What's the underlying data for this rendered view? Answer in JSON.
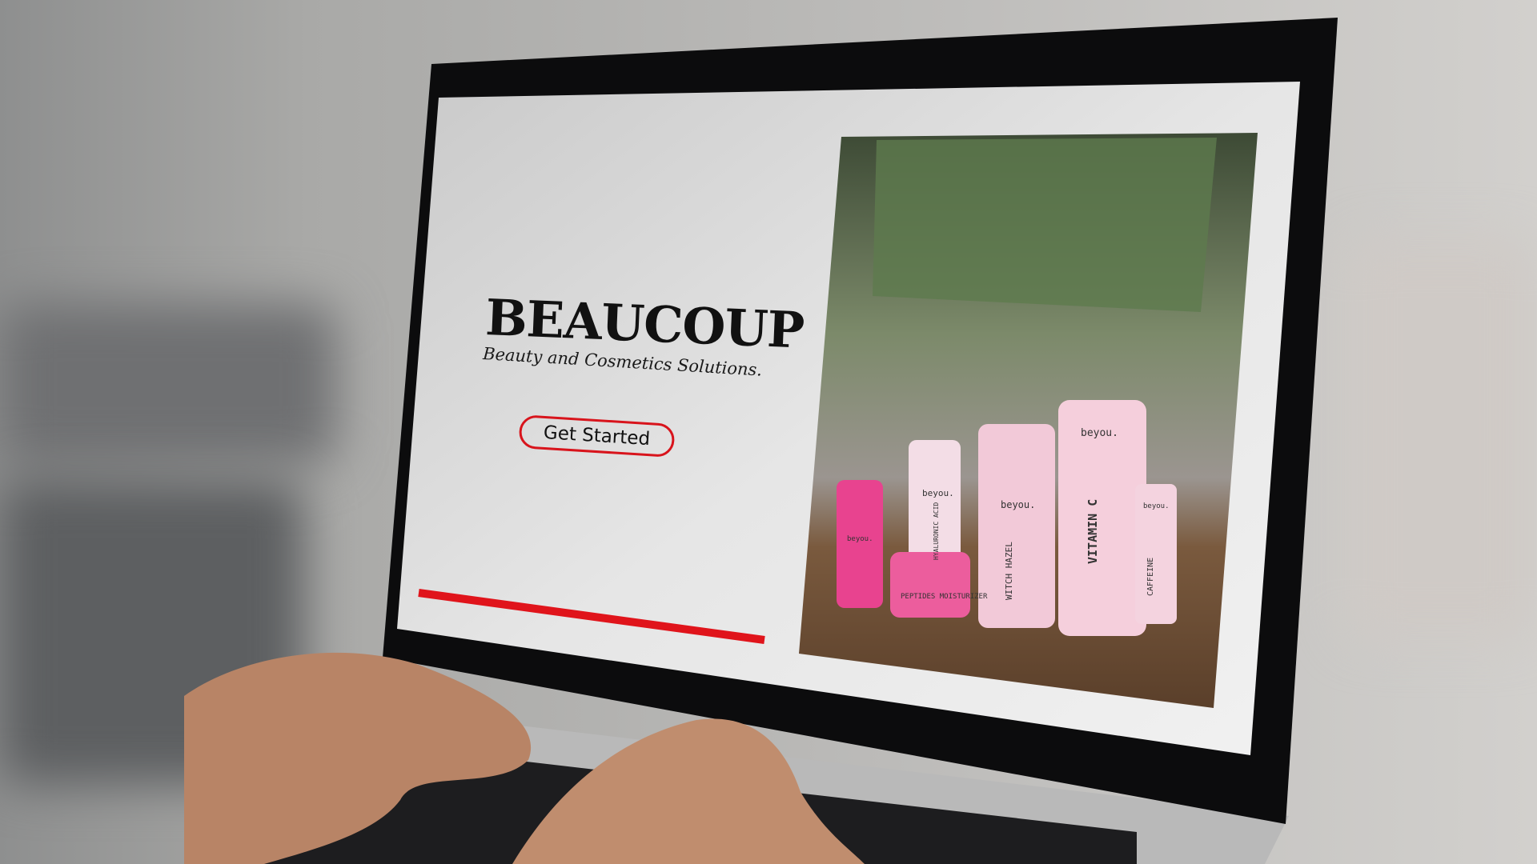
{
  "hero": {
    "brand": "BEAUCOUP",
    "tagline": "Beauty and Cosmetics Solutions.",
    "cta_label": "Get Started"
  },
  "product_photo": {
    "brand_label": "beyou.",
    "products": [
      "HYALURONIC ACID",
      "PEPTIDES MOISTURIZER",
      "WITCH HAZEL",
      "VITAMIN C",
      "CAFFEINE"
    ]
  },
  "colors": {
    "accent": "#d8141c",
    "product_pink": "#e8438f",
    "screen_bg": "#dcdcdc"
  }
}
